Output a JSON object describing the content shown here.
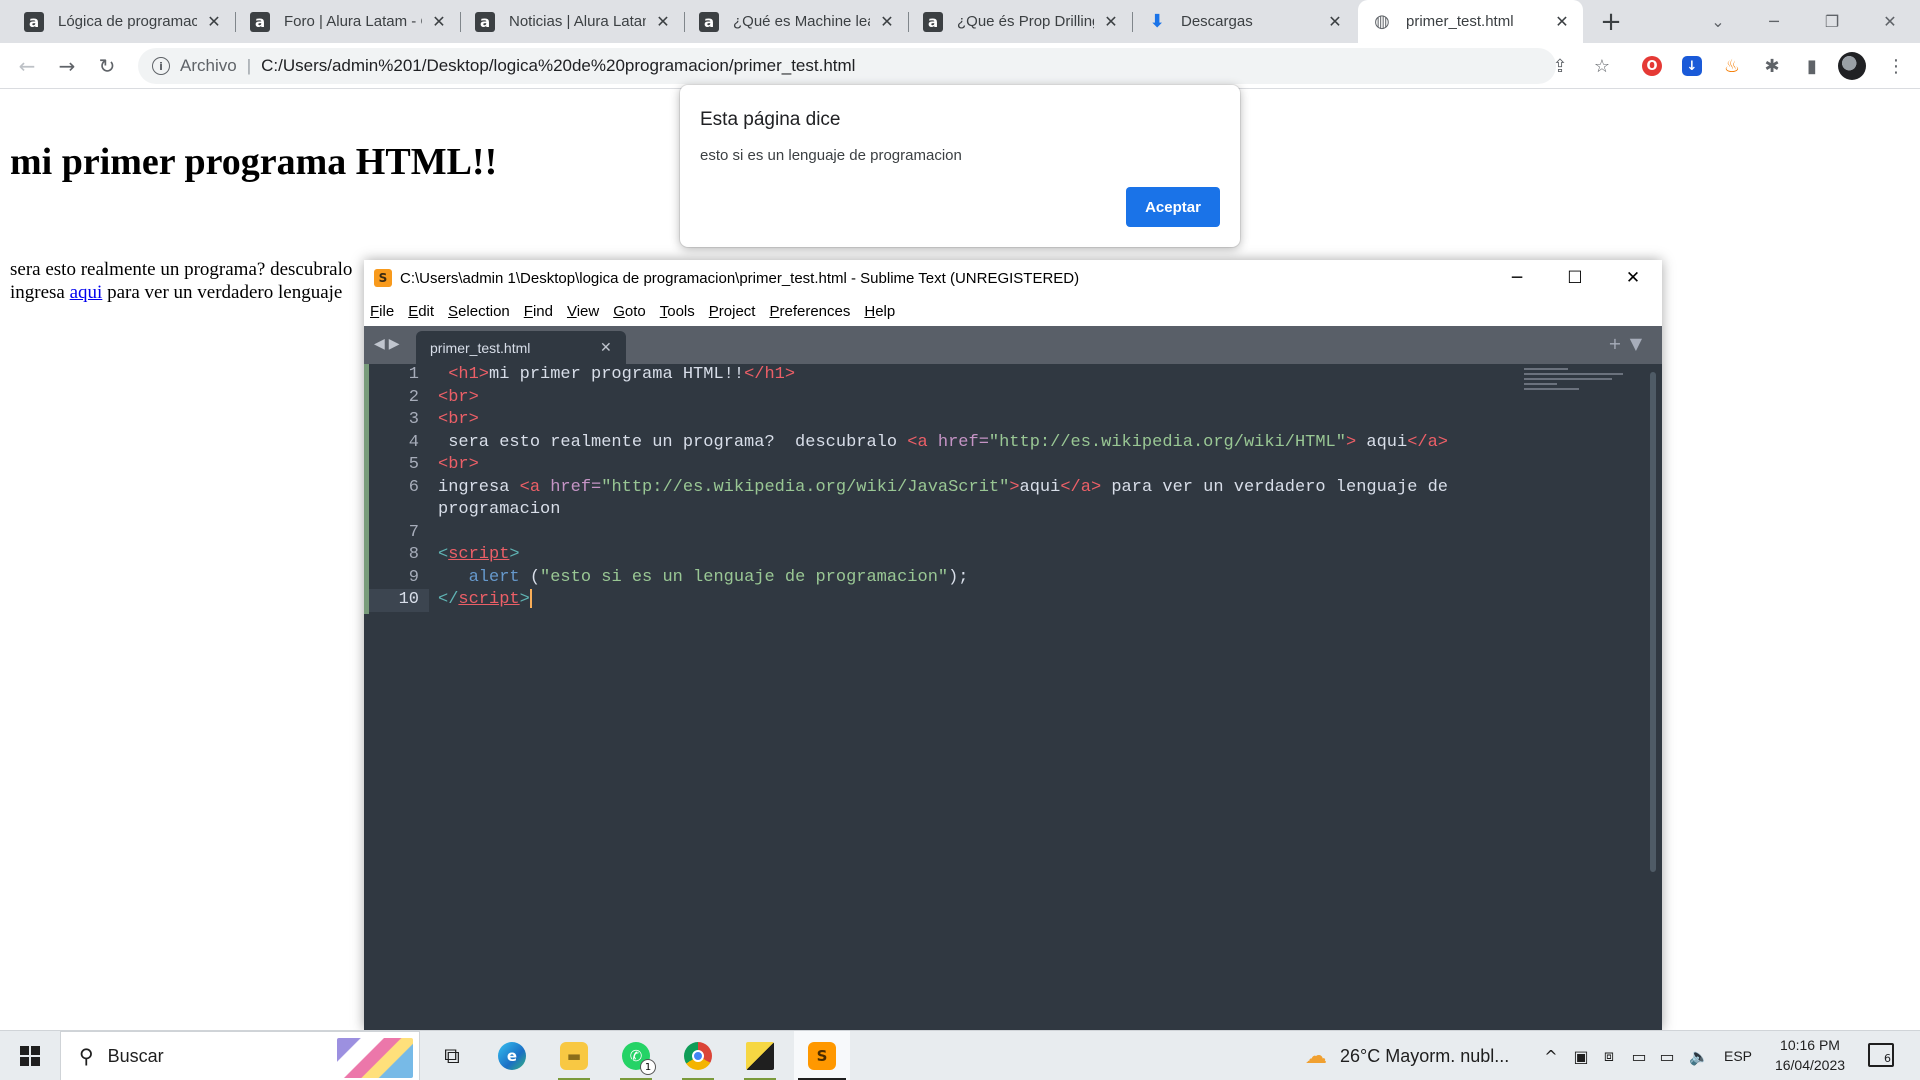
{
  "browser": {
    "tabs": [
      {
        "label": "Lógica de programaci",
        "icon": "alura-icon",
        "fav": "a"
      },
      {
        "label": "Foro | Alura Latam - C",
        "icon": "alura-icon",
        "fav": "a"
      },
      {
        "label": "Noticias | Alura Latam",
        "icon": "alura-icon",
        "fav": "a"
      },
      {
        "label": "¿Qué es Machine lear",
        "icon": "alura-icon",
        "fav": "a"
      },
      {
        "label": "¿Que és Prop Drilling",
        "icon": "alura-icon",
        "fav": "a"
      },
      {
        "label": "Descargas",
        "icon": "download-icon",
        "fav": "⬇"
      },
      {
        "label": "primer_test.html",
        "icon": "globe-icon",
        "fav": "🌐",
        "active": true
      }
    ],
    "new_tab_symbol": "+",
    "omnibox": {
      "scheme_label": "Archivo",
      "url": "C:/Users/admin%201/Desktop/logica%20de%20programacion/primer_test.html"
    }
  },
  "page": {
    "heading": "mi primer programa HTML!!",
    "line1_text": "sera esto realmente un programa? descubralo",
    "line2_before": "ingresa ",
    "line2_link": "aqui",
    "line2_after": " para ver un verdadero lenguaje"
  },
  "alert": {
    "title": "Esta página dice",
    "message": "esto si es un lenguaje de programacion",
    "ok_label": "Aceptar"
  },
  "sublime": {
    "title": "C:\\Users\\admin 1\\Desktop\\logica de programacion\\primer_test.html - Sublime Text (UNREGISTERED)",
    "menu": [
      "File",
      "Edit",
      "Selection",
      "Find",
      "View",
      "Goto",
      "Tools",
      "Project",
      "Preferences",
      "Help"
    ],
    "tab_name": "primer_test.html",
    "line_numbers": [
      "1",
      "2",
      "3",
      "4",
      "5",
      "",
      "6",
      "",
      "7",
      "8",
      "9",
      "10"
    ],
    "current_line": "10",
    "code": {
      "l1_tag_open": "<h1>",
      "l1_text": "mi primer programa HTML!!",
      "l1_tag_close": "</h1>",
      "br": "<br>",
      "l4_text": " sera esto realmente un programa?  descubralo ",
      "l4_a_open": "<a",
      "l4_attr": " href=",
      "l4_url": "\"http://es.wikipedia.org/wiki/HTML\"",
      "l4_gt": ">",
      "l4_link": " aqui",
      "l4_a_close": "</a>",
      "l6_text": "ingresa ",
      "l6_a_open": "<a",
      "l6_attr": " href=",
      "l6_url": "\"http://es.wikipedia.org/wiki/JavaScrit\"",
      "l6_gt": ">",
      "l6_link": "aqui",
      "l6_a_close": "</a>",
      "l6_after": " para ver un verdadero lenguaje de",
      "l6_wrap": "programacion",
      "script_open": "script",
      "script_close": "script",
      "l9_fn": "alert",
      "l9_paren": " (",
      "l9_str": "\"esto si es un lenguaje de programacion\"",
      "l9_end": ");"
    }
  },
  "taskbar": {
    "search_placeholder": "Buscar",
    "weather": "26°C  Mayorm. nubl...",
    "language": "ESP",
    "time": "10:16 PM",
    "date": "16/04/2023",
    "notifications": "6",
    "whatsapp_badge": "1"
  },
  "colors": {
    "sublime_bg": "#303841",
    "accent_blue": "#1a73e8"
  }
}
